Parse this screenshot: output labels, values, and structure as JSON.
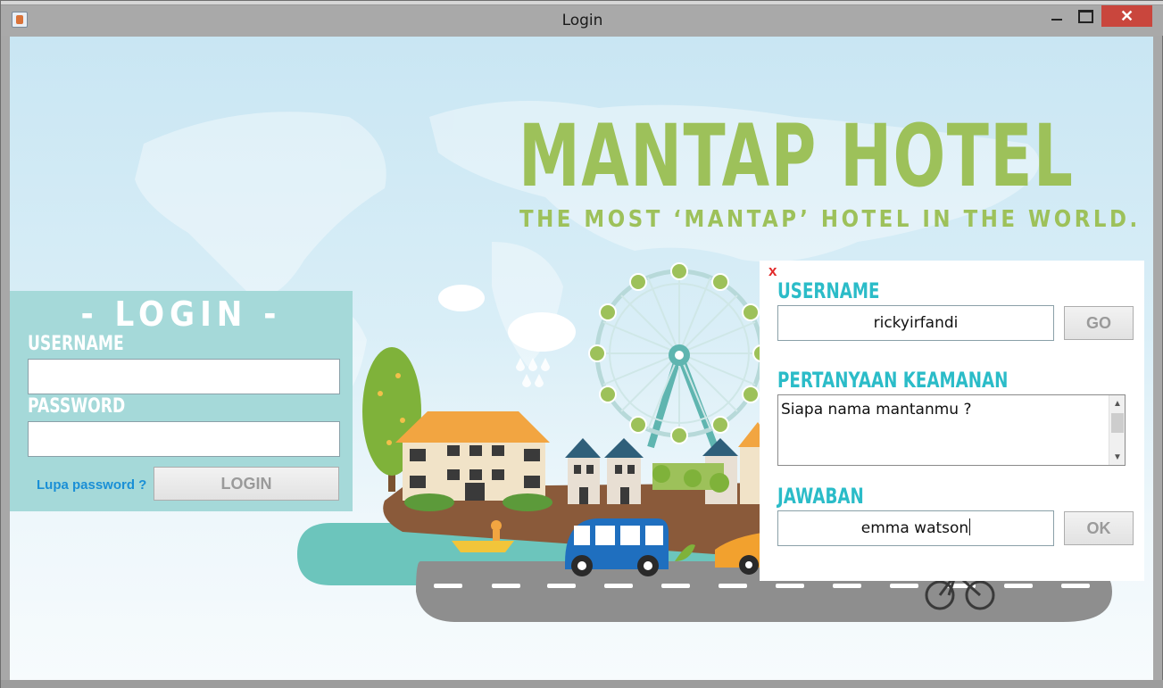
{
  "window": {
    "title": "Login",
    "close_glyph": "✕"
  },
  "brand": {
    "name": "MANTAP HOTEL",
    "tagline": "THE MOST ‘MANTAP’ HOTEL IN THE WORLD."
  },
  "login": {
    "heading": "- LOGIN -",
    "username_label": "USERNAME",
    "username_value": "",
    "password_label": "PASSWORD",
    "password_value": "",
    "forgot_link": "Lupa password ?",
    "login_button": "LOGIN"
  },
  "recovery": {
    "close_label": "x",
    "username_label": "USERNAME",
    "username_value": "rickyirfandi",
    "go_button": "GO",
    "question_label": "PERTANYAAN KEAMANAN",
    "question_value": "Siapa nama mantanmu ?",
    "answer_label": "JAWABAN",
    "answer_value": "emma watson",
    "ok_button": "OK"
  },
  "colors": {
    "brand_green": "#9dc15a",
    "login_panel": "#a5d9d9",
    "teal_label": "#2bbcc8",
    "link_blue": "#1a8fd6",
    "close_red": "#c9463d"
  }
}
